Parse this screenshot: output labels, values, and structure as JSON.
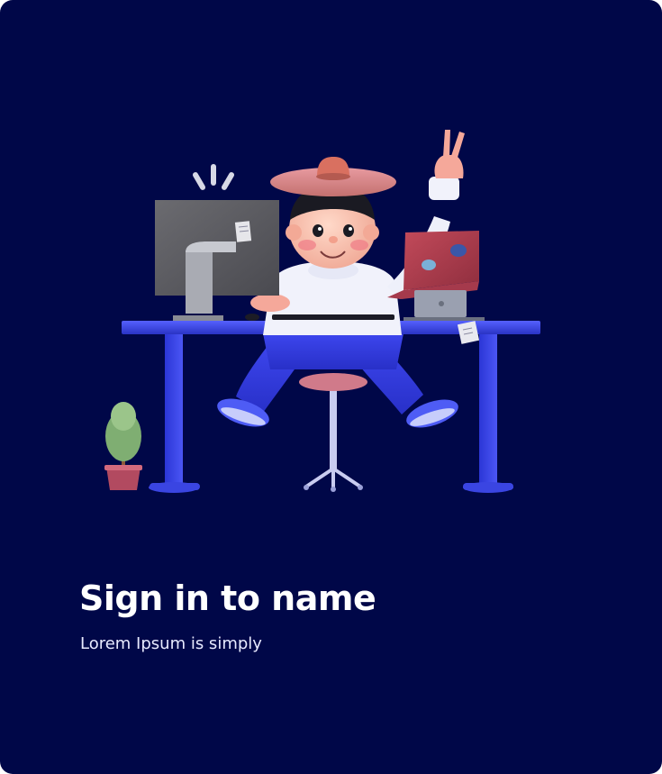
{
  "signin": {
    "title": "Sign in to name",
    "subtitle": "Lorem Ipsum is simply"
  },
  "colors": {
    "background": "#000748",
    "desk": "#3f4ce6",
    "text": "#ffffff"
  }
}
